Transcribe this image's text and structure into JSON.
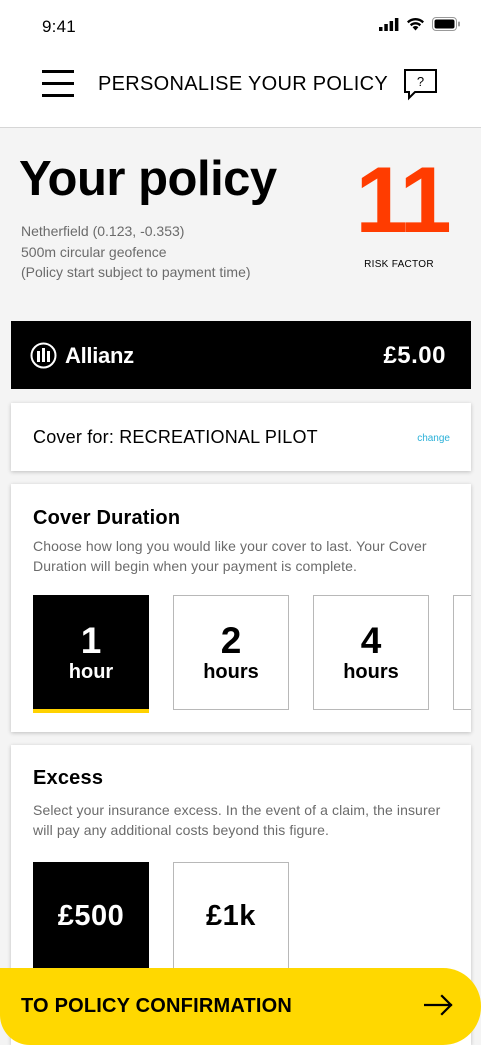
{
  "status_bar": {
    "time": "9:41"
  },
  "nav": {
    "title": "PERSONALISE YOUR POLICY",
    "help_icon_text": "?"
  },
  "policy": {
    "title": "Your policy",
    "location": "Netherfield (0.123, -0.353)",
    "geofence": "500m circular geofence",
    "note": "(Policy start subject to payment time)",
    "risk_factor": "11",
    "risk_label": "RISK FACTOR",
    "risk_color": "#ff3c00"
  },
  "insurer": {
    "name": "Allianz",
    "price": "£5.00"
  },
  "cover": {
    "text": "Cover for: RECREATIONAL PILOT",
    "change_label": "change"
  },
  "duration": {
    "title": "Cover Duration",
    "description": "Choose how long you would like your cover to last. Your Cover Duration will begin when your payment is complete.",
    "options": [
      {
        "value": "1",
        "unit": "hour",
        "selected": true
      },
      {
        "value": "2",
        "unit": "hours",
        "selected": false
      },
      {
        "value": "4",
        "unit": "hours",
        "selected": false
      }
    ]
  },
  "excess": {
    "title": "Excess",
    "description": "Select your insurance excess. In the event of a claim, the insurer will pay any additional costs beyond this figure.",
    "options": [
      {
        "value": "£500",
        "selected": true
      },
      {
        "value": "£1k",
        "selected": false
      }
    ]
  },
  "cta": {
    "label": "TO POLICY CONFIRMATION",
    "icon": "arrow-right-icon"
  },
  "colors": {
    "accent_yellow": "#ffd800",
    "link_blue": "#2ab0d8"
  }
}
